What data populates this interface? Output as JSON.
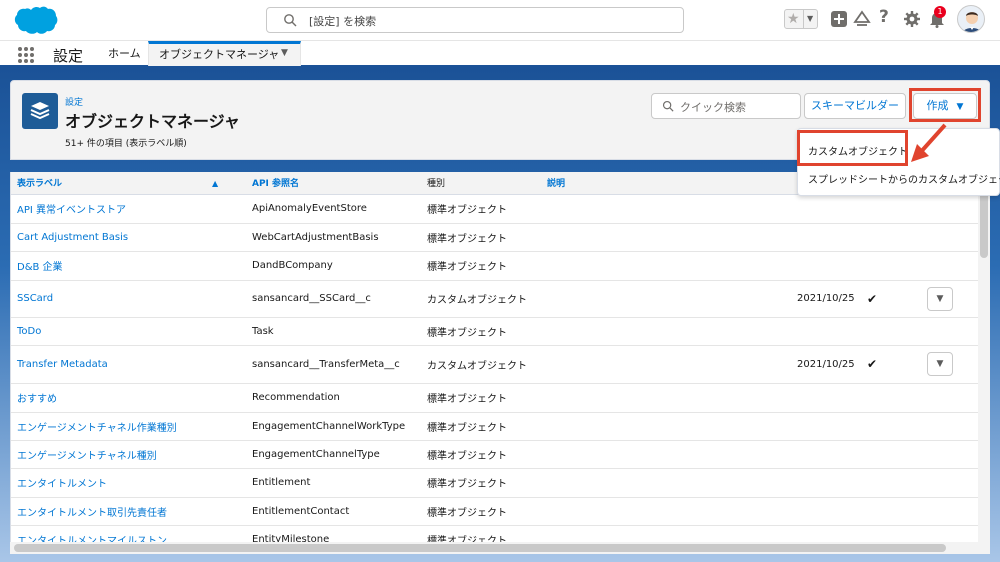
{
  "header": {
    "search_placeholder": "[設定] を検索",
    "notification_count": "1"
  },
  "nav": {
    "app_name": "設定",
    "home": "ホーム",
    "active_tab": "オブジェクトマネージャ"
  },
  "page": {
    "breadcrumb": "設定",
    "title": "オブジェクトマネージャ",
    "meta": "51+ 件の項目 (表示ラベル順)",
    "quick_search_placeholder": "クイック検索",
    "schema_builder": "スキーマビルダー",
    "create": "作成"
  },
  "dropdown": {
    "items": [
      "カスタムオブジェクト",
      "スプレッドシートからのカスタムオブジェクト"
    ]
  },
  "table": {
    "columns": [
      "表示ラベル",
      "API 参照名",
      "種別",
      "説明"
    ],
    "rows": [
      {
        "label": "API 異常イベントストア",
        "api": "ApiAnomalyEventStore",
        "type": "標準オブジェクト",
        "date": "",
        "check": false,
        "action": false
      },
      {
        "label": "Cart Adjustment Basis",
        "api": "WebCartAdjustmentBasis",
        "type": "標準オブジェクト",
        "date": "",
        "check": false,
        "action": false
      },
      {
        "label": "D&B 企業",
        "api": "DandBCompany",
        "type": "標準オブジェクト",
        "date": "",
        "check": false,
        "action": false
      },
      {
        "label": "SSCard",
        "api": "sansancard__SSCard__c",
        "type": "カスタムオブジェクト",
        "date": "2021/10/25",
        "check": true,
        "action": true
      },
      {
        "label": "ToDo",
        "api": "Task",
        "type": "標準オブジェクト",
        "date": "",
        "check": false,
        "action": false
      },
      {
        "label": "Transfer Metadata",
        "api": "sansancard__TransferMeta__c",
        "type": "カスタムオブジェクト",
        "date": "2021/10/25",
        "check": true,
        "action": true
      },
      {
        "label": "おすすめ",
        "api": "Recommendation",
        "type": "標準オブジェクト",
        "date": "",
        "check": false,
        "action": false
      },
      {
        "label": "エンゲージメントチャネル作業種別",
        "api": "EngagementChannelWorkType",
        "type": "標準オブジェクト",
        "date": "",
        "check": false,
        "action": false
      },
      {
        "label": "エンゲージメントチャネル種別",
        "api": "EngagementChannelType",
        "type": "標準オブジェクト",
        "date": "",
        "check": false,
        "action": false
      },
      {
        "label": "エンタイトルメント",
        "api": "Entitlement",
        "type": "標準オブジェクト",
        "date": "",
        "check": false,
        "action": false
      },
      {
        "label": "エンタイトルメント取引先責任者",
        "api": "EntitlementContact",
        "type": "標準オブジェクト",
        "date": "",
        "check": false,
        "action": false
      },
      {
        "label": "エンタイトルメントマイルストン",
        "api": "EntityMilestone",
        "type": "標準オブジェクト",
        "date": "",
        "check": false,
        "action": false
      }
    ]
  },
  "colors": {
    "brand_blue": "#1b5297",
    "link": "#0176d3",
    "highlight": "#e0442e"
  }
}
